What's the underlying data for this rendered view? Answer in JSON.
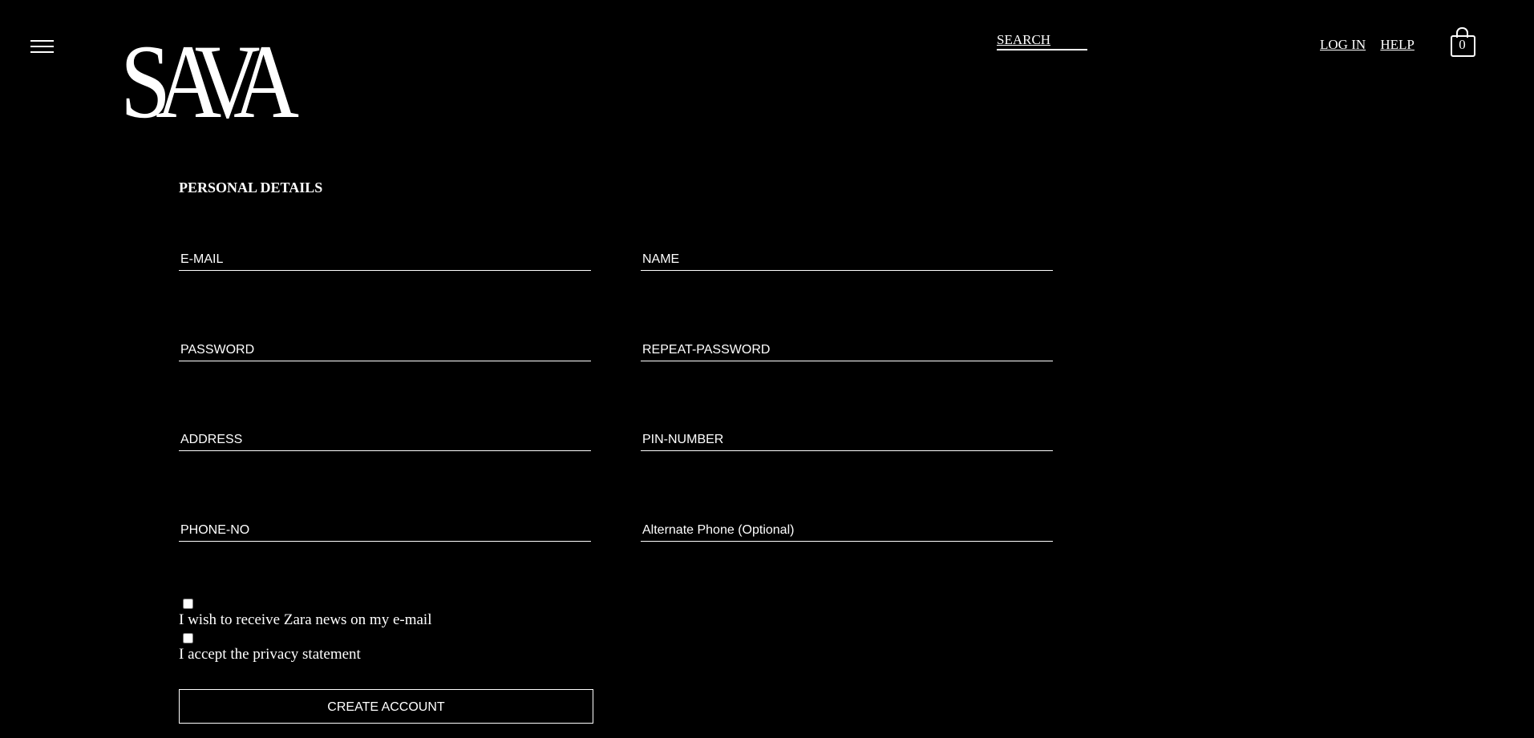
{
  "header": {
    "logo_text": "SAVA",
    "search_label": "SEARCH",
    "login_label": "LOG IN",
    "help_label": "HELP",
    "cart_count": "0"
  },
  "form": {
    "section_title": "PERSONAL DETAILS",
    "email_placeholder": "E-MAIL",
    "name_placeholder": "NAME",
    "password_placeholder": "PASSWORD",
    "repeat_password_placeholder": "REPEAT-PASSWORD",
    "address_placeholder": "ADDRESS",
    "pin_placeholder": "PIN-NUMBER",
    "phone_placeholder": "PHONE-NO",
    "alt_phone_placeholder": "Alternate Phone (Optional)",
    "newsletter_label": "I wish to receive Zara news on my e-mail",
    "privacy_label": "I accept the privacy statement",
    "submit_label": "CREATE ACCOUNT"
  },
  "colors": {
    "background": "#000000",
    "foreground": "#ffffff"
  },
  "icons": [
    "menu-icon",
    "shopping-bag-icon"
  ]
}
